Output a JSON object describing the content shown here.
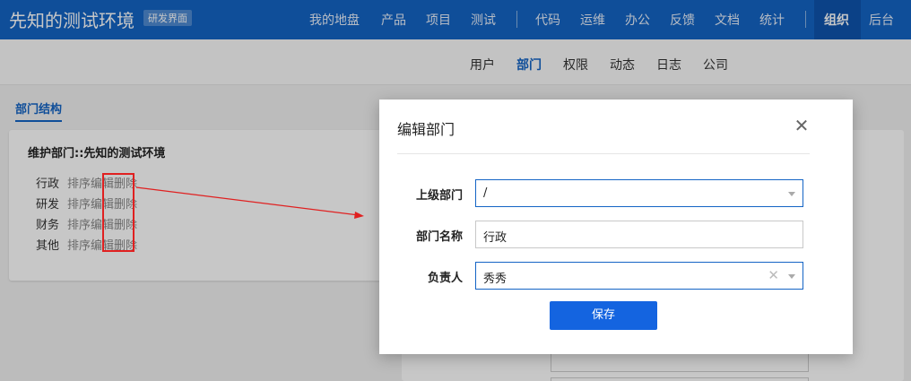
{
  "app": {
    "brand": "先知的测试环境",
    "brand_tag": "研发界面"
  },
  "topnav": {
    "items": [
      "我的地盘",
      "产品",
      "项目",
      "测试",
      "代码",
      "运维",
      "办公",
      "反馈",
      "文档",
      "统计",
      "组织",
      "后台"
    ],
    "active": "组织"
  },
  "subnav": {
    "items": [
      "用户",
      "部门",
      "权限",
      "动态",
      "日志",
      "公司"
    ],
    "active": "部门"
  },
  "left_tab": "部门结构",
  "panel": {
    "title": "维护部门::先知的测试环境",
    "departments": [
      {
        "name": "行政",
        "sort": "排序",
        "edit": "编辑",
        "delete": "删除"
      },
      {
        "name": "研发",
        "sort": "排序",
        "edit": "编辑",
        "delete": "删除"
      },
      {
        "name": "财务",
        "sort": "排序",
        "edit": "编辑",
        "delete": "删除"
      },
      {
        "name": "其他",
        "sort": "排序",
        "edit": "编辑",
        "delete": "删除"
      }
    ]
  },
  "modal": {
    "title": "编辑部门",
    "close_icon": "close-icon",
    "parent_label": "上级部门",
    "parent_value": "/",
    "name_label": "部门名称",
    "name_value": "行政",
    "manager_label": "负责人",
    "manager_value": "秀秀",
    "save_label": "保存"
  },
  "colors": {
    "brand": "#1464c5",
    "annotation": "#e02020",
    "button": "#1464e0"
  }
}
